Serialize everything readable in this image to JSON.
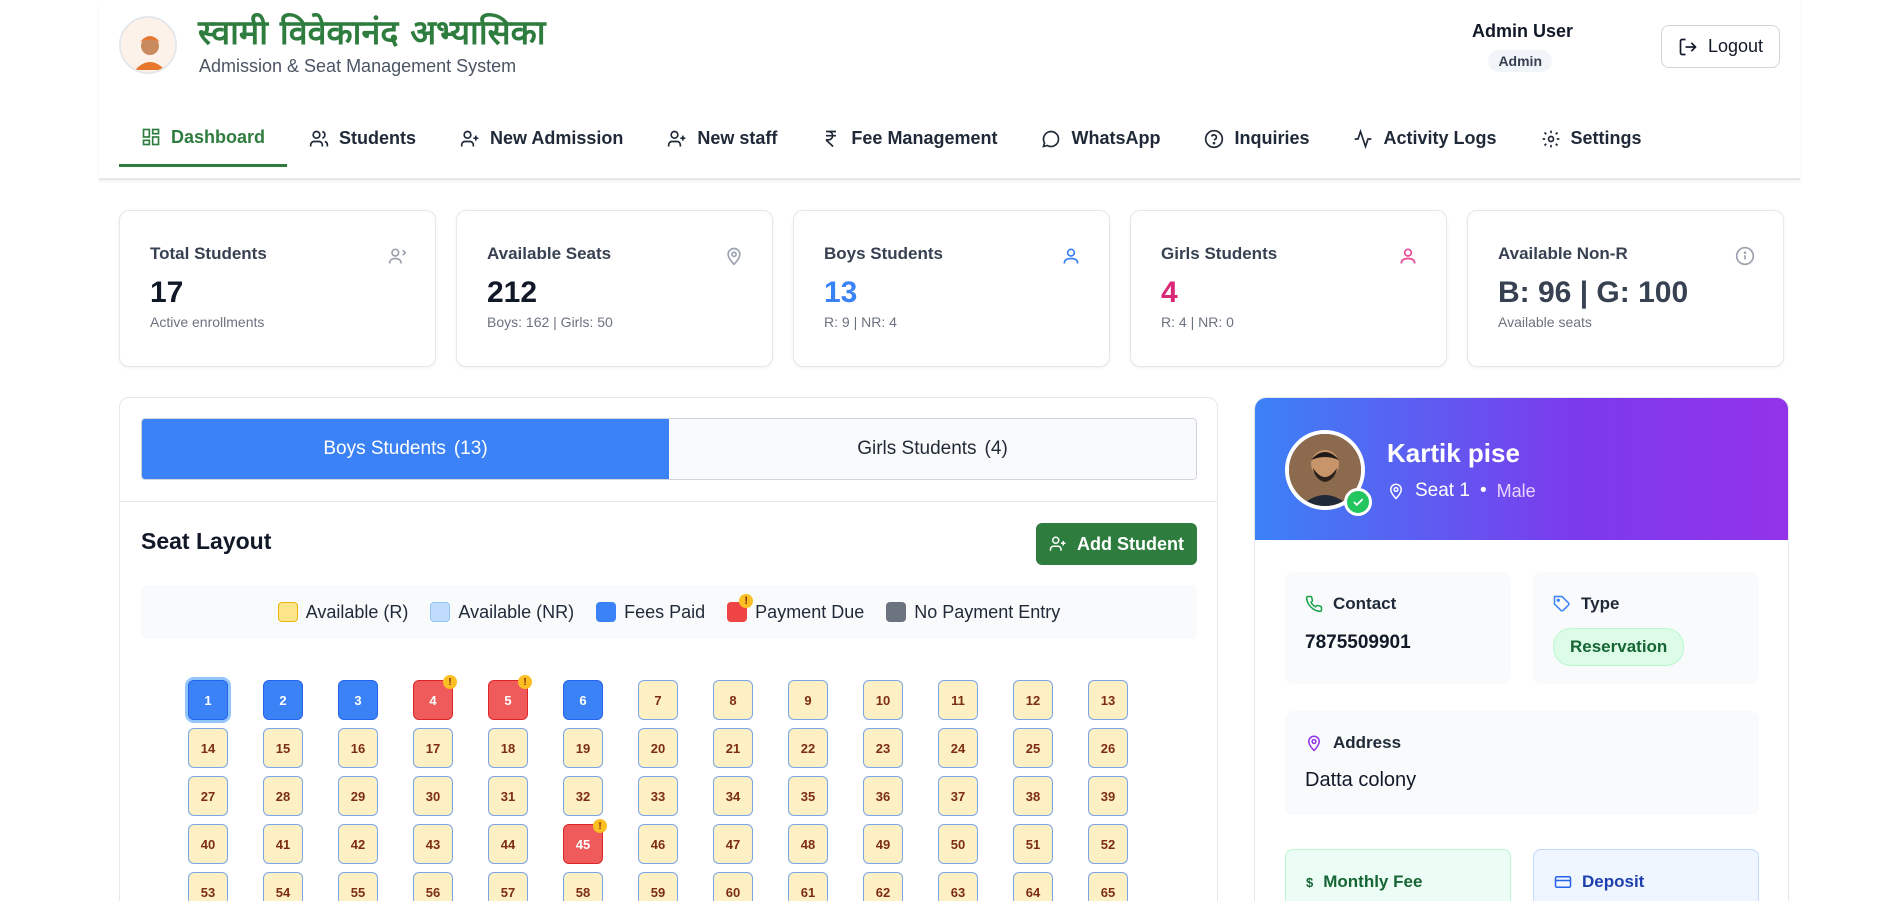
{
  "header": {
    "title": "स्वामी विवेकानंद अभ्यासिका",
    "subtitle": "Admission & Seat Management System",
    "user_name": "Admin User",
    "user_role": "Admin",
    "logout_label": "Logout"
  },
  "nav": {
    "items": [
      {
        "label": "Dashboard",
        "icon": "dashboard-icon",
        "active": true
      },
      {
        "label": "Students",
        "icon": "users-icon"
      },
      {
        "label": "New Admission",
        "icon": "user-plus-icon"
      },
      {
        "label": "New staff",
        "icon": "user-plus-icon"
      },
      {
        "label": "Fee Management",
        "icon": "rupee-icon"
      },
      {
        "label": "WhatsApp",
        "icon": "chat-icon"
      },
      {
        "label": "Inquiries",
        "icon": "help-circle-icon"
      },
      {
        "label": "Activity Logs",
        "icon": "activity-icon"
      },
      {
        "label": "Settings",
        "icon": "gear-icon"
      }
    ]
  },
  "stats": [
    {
      "label": "Total Students",
      "value": "17",
      "sub": "Active enrollments",
      "color": "#111827"
    },
    {
      "label": "Available Seats",
      "value": "212",
      "sub": "Boys: 162 | Girls: 50",
      "color": "#111827"
    },
    {
      "label": "Boys Students",
      "value": "13",
      "sub": "R: 9 | NR: 4",
      "color": "#3b82f6"
    },
    {
      "label": "Girls Students",
      "value": "4",
      "sub": "R: 4 | NR: 0",
      "color": "#db2777"
    },
    {
      "label": "Available Non-R",
      "value": "B: 96 | G: 100",
      "sub": "Available seats",
      "color": "#374151"
    }
  ],
  "tabs": {
    "boys_label": "Boys Students",
    "boys_count": "(13)",
    "girls_label": "Girls Students",
    "girls_count": "(4)"
  },
  "seat_layout": {
    "title": "Seat Layout",
    "add_label": "Add Student",
    "legend": [
      {
        "label": "Available (R)",
        "color": "#fde68a",
        "border": "#eab308"
      },
      {
        "label": "Available (NR)",
        "color": "#bfdbfe",
        "border": "#93c5fd"
      },
      {
        "label": "Fees Paid",
        "color": "#3b82f6",
        "border": "#3b82f6"
      },
      {
        "label": "Payment Due",
        "color": "#ef4444",
        "border": "#ef4444",
        "badge": "!"
      },
      {
        "label": "No Payment Entry",
        "color": "#6b7280",
        "border": "#6b7280"
      }
    ],
    "paid_seats": [
      1,
      2,
      3,
      6
    ],
    "due_seats": [
      4,
      5,
      45
    ],
    "selected_seat": 1,
    "visible_seat_count": 65
  },
  "profile": {
    "name": "Kartik pise",
    "seat": "Seat 1",
    "gender": "Male",
    "contact_label": "Contact",
    "contact_value": "7875509901",
    "type_label": "Type",
    "type_value": "Reservation",
    "address_label": "Address",
    "address_value": "Datta colony",
    "monthly_fee_label": "Monthly Fee",
    "deposit_label": "Deposit"
  }
}
